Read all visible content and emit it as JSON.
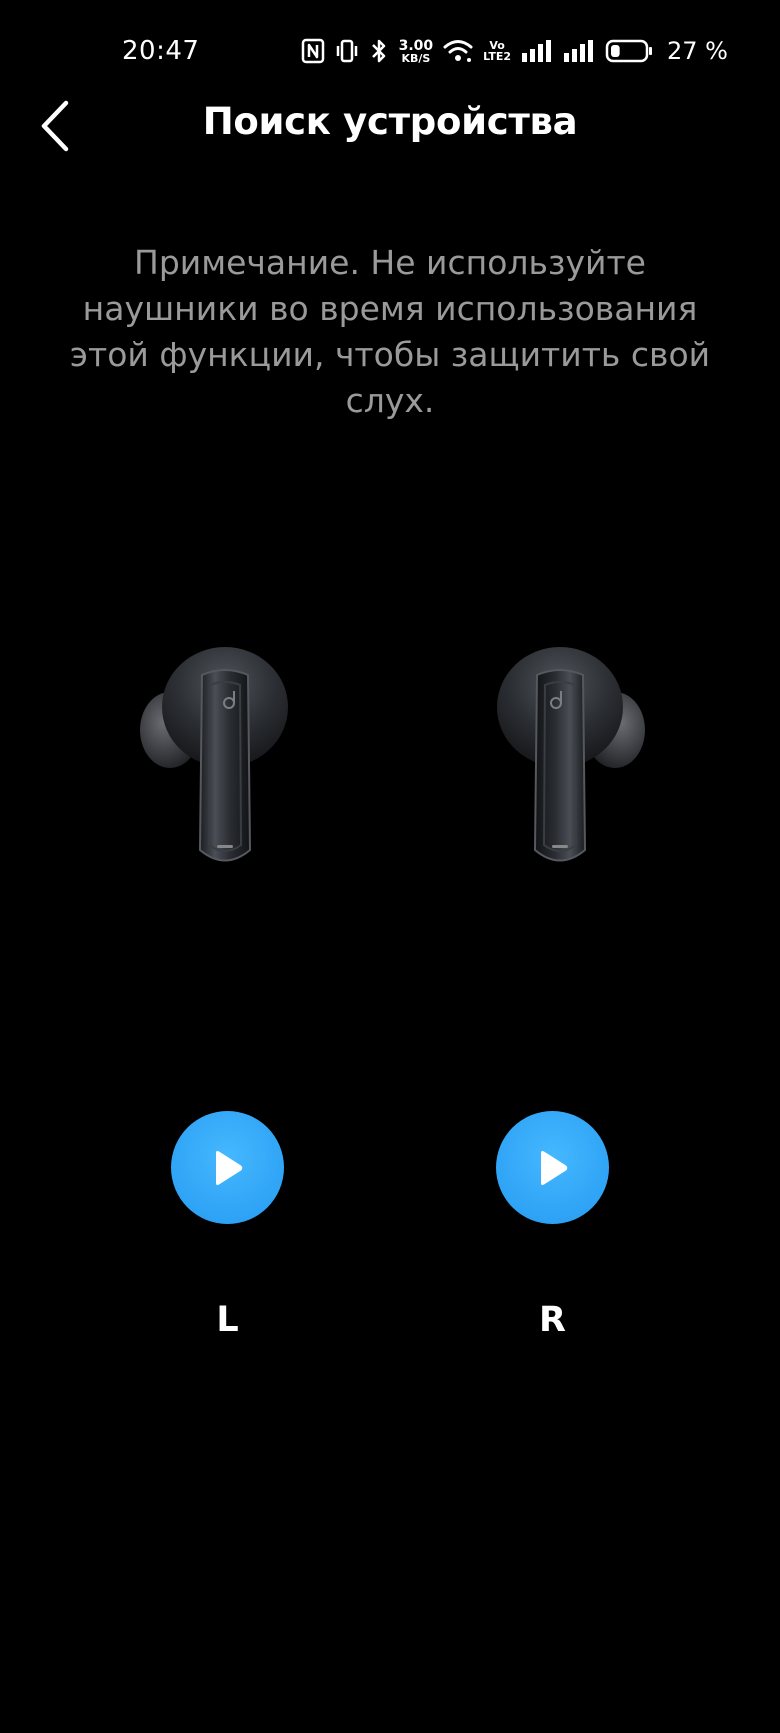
{
  "status_bar": {
    "time": "20:47",
    "net_speed_value": "3.00",
    "net_speed_unit": "KB/S",
    "volte_top": "Vo",
    "volte_bottom": "LTE2",
    "battery_percent": "27 %",
    "battery_level": 0.27,
    "icons": [
      "nfc-icon",
      "vibrate-icon",
      "bluetooth-icon",
      "wifi-icon",
      "signal-sim1-icon",
      "signal-sim2-icon",
      "battery-icon"
    ]
  },
  "header": {
    "title": "Поиск устройства",
    "back_icon": "chevron-left-icon"
  },
  "note": {
    "text": "Примечание. Не используйте наушники во время использования этой функции, чтобы защитить свой слух."
  },
  "earbuds": {
    "left": {
      "label": "L",
      "play_icon": "play-icon"
    },
    "right": {
      "label": "R",
      "play_icon": "play-icon"
    }
  },
  "colors": {
    "background": "#000000",
    "accent": "#2fa3f5",
    "note_text": "#9a9a9a",
    "text": "#ffffff"
  }
}
